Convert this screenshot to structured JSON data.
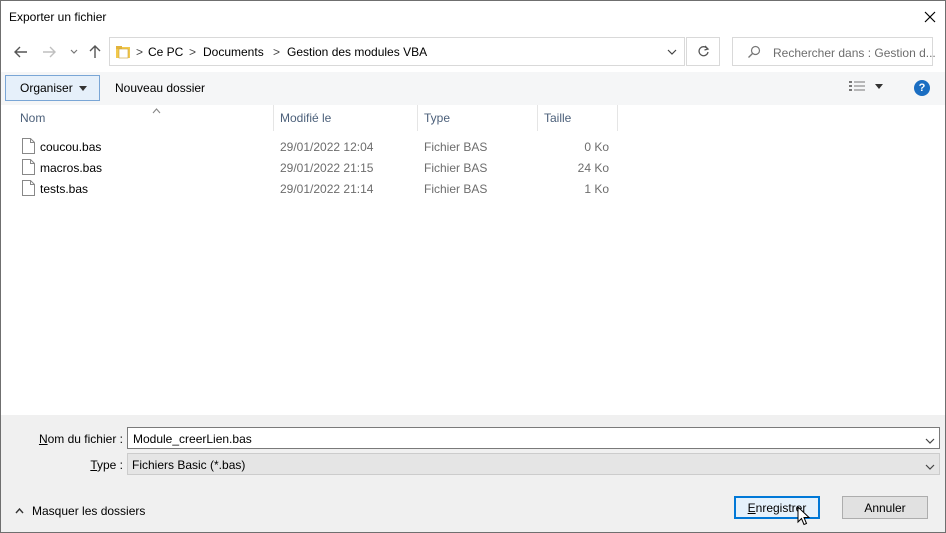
{
  "window": {
    "title": "Exporter un fichier"
  },
  "address": {
    "crumbs": [
      "Ce PC",
      "Documents",
      "Gestion des modules VBA"
    ],
    "separator": ">"
  },
  "search": {
    "placeholder": "Rechercher dans : Gestion d..."
  },
  "toolbar": {
    "organiser_label": "Organiser",
    "new_folder_label": "Nouveau dossier",
    "help_label": "?"
  },
  "columns": {
    "name": "Nom",
    "modified": "Modifié le",
    "type": "Type",
    "size": "Taille"
  },
  "files": [
    {
      "name": "coucou.bas",
      "modified": "29/01/2022 12:04",
      "type": "Fichier BAS",
      "size": "0 Ko"
    },
    {
      "name": "macros.bas",
      "modified": "29/01/2022 21:15",
      "type": "Fichier BAS",
      "size": "24 Ko"
    },
    {
      "name": "tests.bas",
      "modified": "29/01/2022 21:14",
      "type": "Fichier BAS",
      "size": "1 Ko"
    }
  ],
  "form": {
    "filename_label_mnemonic": "N",
    "filename_label_rest": "om du fichier :",
    "filename_value": "Module_creerLien.bas",
    "type_label_mnemonic": "T",
    "type_label_rest": "ype :",
    "type_value": "Fichiers Basic (*.bas)"
  },
  "footer": {
    "hide_folders_label": "Masquer les dossiers",
    "save_mnemonic": "E",
    "save_rest": "nregistrer",
    "cancel_label": "Annuler"
  },
  "colors": {
    "accent": "#0078d7",
    "help": "#1b6ec2",
    "footer_bg": "#f0f0f0",
    "toolbar_bg": "#f5f6f7"
  }
}
